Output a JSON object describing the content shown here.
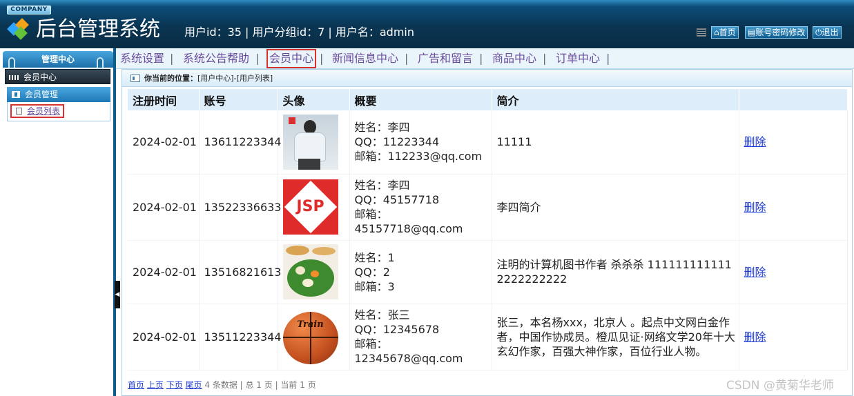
{
  "header": {
    "company": "COMPANY",
    "title": "后台管理系统",
    "user_info": "用户id：35 | 用户分组id：7 | 用户名：admin",
    "buttons": [
      {
        "label": "首页",
        "icon": "home-icon"
      },
      {
        "label": "账号密码修改",
        "icon": "document-icon"
      },
      {
        "label": "退出",
        "icon": "power-icon"
      }
    ]
  },
  "nav": {
    "items": [
      "系统设置",
      "系统公告帮助",
      "会员中心",
      "新闻信息中心",
      "广告和留言",
      "商品中心",
      "订单中心"
    ],
    "separator": "|",
    "active": "会员中心"
  },
  "sidebar": {
    "title": "管理中心",
    "section": "会员中心",
    "group": "会员管理",
    "link": "会员列表"
  },
  "breadcrumb": {
    "label": "你当前的位置：",
    "path": "[用户中心]-[用户列表]"
  },
  "table": {
    "headers": [
      "注册时间",
      "账号",
      "头像",
      "概要",
      "简介",
      ""
    ],
    "rows": [
      {
        "date": "2024-02-01",
        "account": "13611223344",
        "avatar": "person-photo",
        "summary": [
          "姓名：李四",
          "QQ：11223344",
          "邮箱：112233@qq.com"
        ],
        "intro": "11111",
        "action": "删除"
      },
      {
        "date": "2024-02-01",
        "account": "13522336633",
        "avatar": "jsp-logo",
        "summary": [
          "姓名：李四",
          "QQ：45157718",
          "邮箱：45157718@qq.com"
        ],
        "intro": "李四简介",
        "action": "删除"
      },
      {
        "date": "2024-02-01",
        "account": "13516821613",
        "avatar": "food-photo",
        "summary": [
          "姓名：1",
          "QQ：2",
          "邮箱：3"
        ],
        "intro": "注明的计算机图书作者 杀杀杀 111111111111 2222222222",
        "action": "删除"
      },
      {
        "date": "2024-02-01",
        "account": "13511223344",
        "avatar": "basketball-photo",
        "summary": [
          "姓名：张三",
          "QQ：12345678",
          "邮箱：12345678@qq.com"
        ],
        "intro": "张三，本名杨xxx，北京人 。起点中文网白金作者，中国作协成员。橙瓜见证·网络文学20年十大玄幻作家，百强大神作家，百位行业人物。",
        "action": "删除"
      }
    ],
    "ball_brand": "Train"
  },
  "pager": {
    "first": "首页",
    "prev": "上页",
    "next": "下页",
    "last": "尾页",
    "info": "4 条数据 | 总 1 页 | 当前 1 页"
  },
  "watermark": "CSDN @黄菊华老师",
  "colors": {
    "header_dark": "#0a2d45",
    "accent": "#1e78b6",
    "highlight_box": "#d8322f",
    "link": "#1f3bd6"
  }
}
